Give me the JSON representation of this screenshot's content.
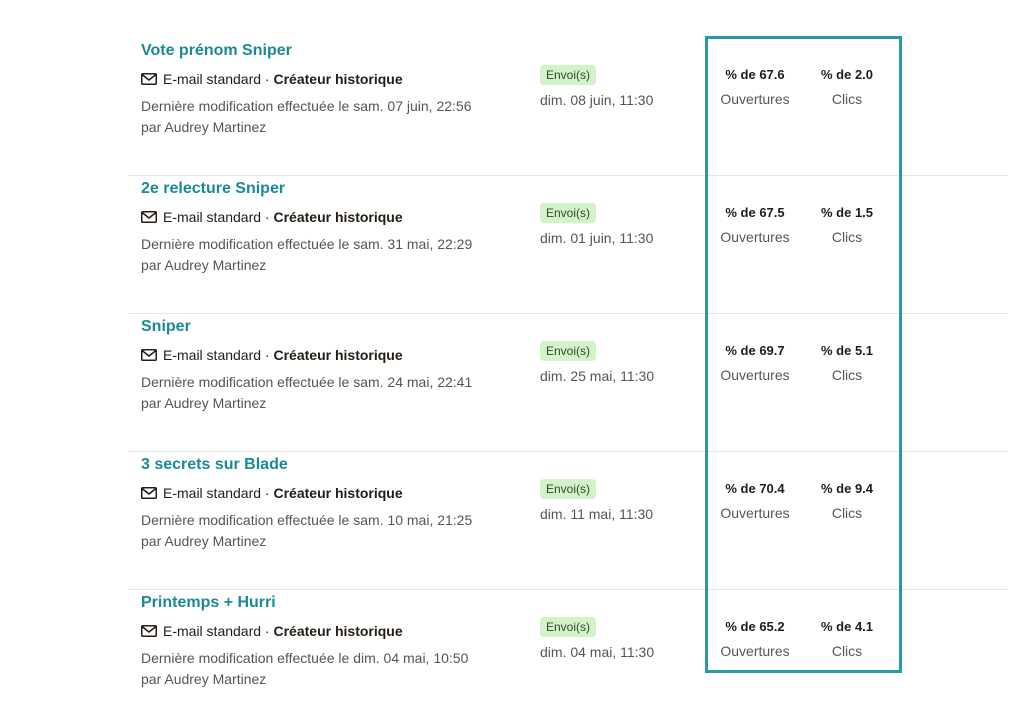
{
  "campaigns": [
    {
      "title": "Vote prénom Sniper",
      "type": "E-mail standard",
      "separator": " · ",
      "creator": "Créateur historique",
      "modified_line1": "Dernière modification effectuée le sam. 07 juin, 22:56",
      "modified_line2": "par Audrey Martinez",
      "status": "Envoi(s)",
      "sent_date": "dim. 08 juin, 11:30",
      "opens_value": "% de 67.6",
      "opens_label": "Ouvertures",
      "clicks_value": "% de 2.0",
      "clicks_label": "Clics"
    },
    {
      "title": "2e relecture Sniper",
      "type": "E-mail standard",
      "separator": " · ",
      "creator": "Créateur historique",
      "modified_line1": "Dernière modification effectuée le sam. 31 mai, 22:29",
      "modified_line2": "par Audrey Martinez",
      "status": "Envoi(s)",
      "sent_date": "dim. 01 juin, 11:30",
      "opens_value": "% de 67.5",
      "opens_label": "Ouvertures",
      "clicks_value": "% de 1.5",
      "clicks_label": "Clics"
    },
    {
      "title": "Sniper",
      "type": "E-mail standard",
      "separator": " · ",
      "creator": "Créateur historique",
      "modified_line1": "Dernière modification effectuée le sam. 24 mai, 22:41",
      "modified_line2": "par Audrey Martinez",
      "status": "Envoi(s)",
      "sent_date": "dim. 25 mai, 11:30",
      "opens_value": "% de 69.7",
      "opens_label": "Ouvertures",
      "clicks_value": "% de 5.1",
      "clicks_label": "Clics"
    },
    {
      "title": "3 secrets sur Blade",
      "type": "E-mail standard",
      "separator": " · ",
      "creator": "Créateur historique",
      "modified_line1": "Dernière modification effectuée le sam. 10 mai, 21:25",
      "modified_line2": "par Audrey Martinez",
      "status": "Envoi(s)",
      "sent_date": "dim. 11 mai, 11:30",
      "opens_value": "% de 70.4",
      "opens_label": "Ouvertures",
      "clicks_value": "% de 9.4",
      "clicks_label": "Clics"
    },
    {
      "title": "Printemps + Hurri",
      "type": "E-mail standard",
      "separator": " · ",
      "creator": "Créateur historique",
      "modified_line1": "Dernière modification effectuée le dim. 04 mai, 10:50",
      "modified_line2": "par Audrey Martinez",
      "status": "Envoi(s)",
      "sent_date": "dim. 04 mai, 11:30",
      "opens_value": "% de 65.2",
      "opens_label": "Ouvertures",
      "clicks_value": "% de 4.1",
      "clicks_label": "Clics"
    }
  ],
  "icons": {
    "type_icon": "envelope-icon"
  },
  "colors": {
    "title": "#1a8a94",
    "badge_bg": "#d3f2c9",
    "badge_text": "#2e4a2a",
    "highlight_border": "#2b9aa0",
    "divider": "#e6e6e6"
  }
}
